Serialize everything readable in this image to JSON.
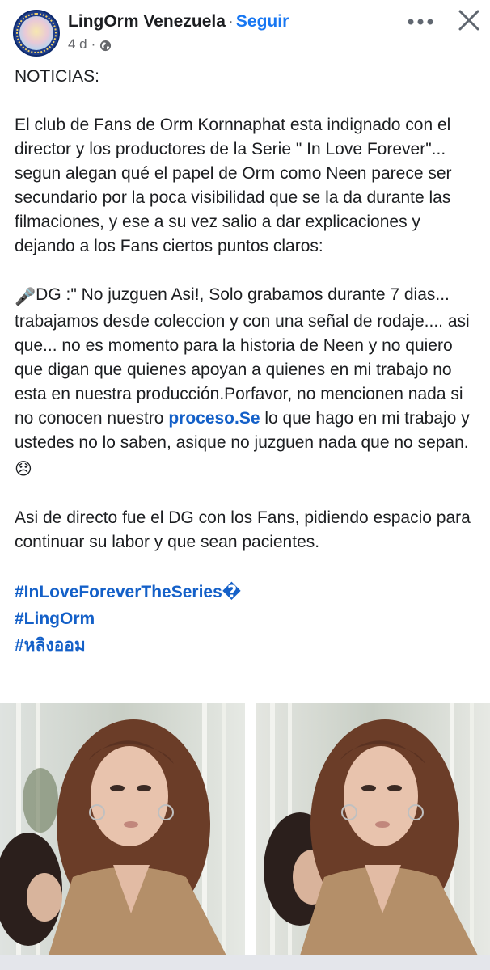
{
  "header": {
    "page_name": "LingOrm Venezuela",
    "separator": "·",
    "follow_label": "Seguir",
    "time": "4 d",
    "meta_dot": "·",
    "privacy_icon": "globe-icon",
    "more_icon": "more-dots-icon",
    "close_icon": "close-icon",
    "avatar_icon": "page-avatar"
  },
  "post": {
    "p1": "NOTICIAS:",
    "p2": "El club de Fans de Orm Kornnaphat  esta indignado con el director y los productores de la Serie \" In Love Forever\"... segun alegan qué el papel de Orm como Neen parece ser secundario por la poca visibilidad que se la da durante las filmaciones, y ese a su vez salio a dar explicaciones y dejando a los Fans ciertos puntos claros:",
    "p3_emoji": "🎤",
    "p3_part1": "DG :\" No juzguen Asi!, Solo grabamos durante 7 dias... trabajamos desde coleccion y con una señal de rodaje.... asi que... no es momento para la historia de Neen y no quiero que digan que quienes apoyan a quienes en mi trabajo no esta en nuestra producción.Porfavor, no mencionen nada si no conocen nuestro ",
    "p3_link": "proceso.Se",
    "p3_part2": " lo que hago en mi trabajo y ustedes no lo saben, asique no juzguen nada que no sepan.",
    "p3_end_emoji": "😞",
    "p4": "Asi de directo fue el DG con los Fans, pidiendo espacio para continuar su labor y que sean pacientes.",
    "tags": [
      "#InLoveForeverTheSeries�",
      "#LingOrm",
      "#หลิงออม"
    ]
  },
  "colors": {
    "link": "#1460c8",
    "follow": "#1877f2",
    "meta": "#65676b"
  }
}
